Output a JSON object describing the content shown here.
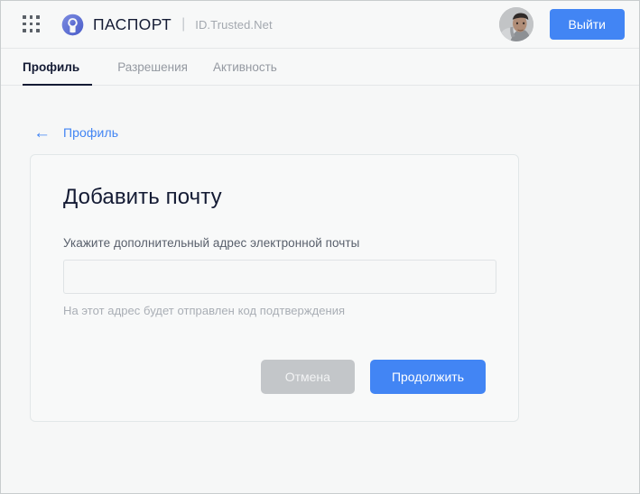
{
  "header": {
    "apps_icon": "apps-grid-icon",
    "logo_icon": "passport-ring-logo-icon",
    "brand_name": "ПАСПОРТ",
    "brand_separator": "|",
    "brand_subtitle": "ID.Trusted.Net",
    "avatar_icon": "user-avatar-photo",
    "logout_label": "Выйти"
  },
  "tabs": [
    {
      "label": "Профиль",
      "active": true
    },
    {
      "label": "Разрешения",
      "active": false
    },
    {
      "label": "Активность",
      "active": false
    }
  ],
  "breadcrumb": {
    "back_icon": "arrow-left-icon",
    "back_glyph": "←",
    "link_label": "Профиль"
  },
  "card": {
    "title": "Добавить почту",
    "field_label": "Укажите дополнительный адрес электронной почты",
    "input_value": "",
    "input_placeholder": "",
    "hint": "На этот адрес будет отправлен код подтверждения",
    "cancel_label": "Отмена",
    "submit_label": "Продолжить"
  },
  "colors": {
    "accent_blue": "#4285f4",
    "ink_navy": "#141b34",
    "muted_gray": "#9499a1",
    "disabled_gray": "#c3c6c9",
    "page_bg": "#f6f7f7",
    "card_bg": "#f8f9f9",
    "border": "#e2e7e8",
    "logo_blue": "#5b6fd6"
  }
}
